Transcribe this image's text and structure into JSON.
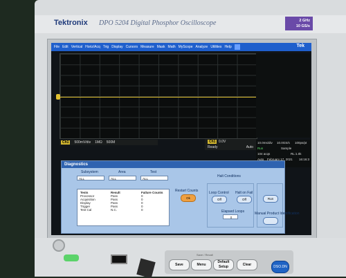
{
  "device": {
    "brand": "Tektronix",
    "model": "DPO 5204 Digital Phosphor Oscilloscope",
    "spec_line1": "2 GHz",
    "spec_line2": "10 GS/s"
  },
  "menubar": {
    "items": [
      "File",
      "Edit",
      "Vertical",
      "Horiz/Acq",
      "Trig",
      "Display",
      "Cursors",
      "Measure",
      "Mask",
      "Math",
      "MyScope",
      "Analyze",
      "Utilities",
      "Help"
    ],
    "logo": "Tek"
  },
  "channel": {
    "badge": "Ch1",
    "scale": "500mV/div",
    "impedance": "1MΩ",
    "bandwidth": "500M"
  },
  "trigger": {
    "badge": "Ch1",
    "level": "0.0V",
    "state": "Ready",
    "mode": "Auto"
  },
  "acquisition": {
    "timebase": "10.0ms/div",
    "rate": "10.0GS/s",
    "points": "100ps/pt",
    "run": "Run",
    "sample": "Sample",
    "acqs": "104 acqs",
    "rl": "RL:1.0k",
    "auto": "Auto",
    "date": "February 17, 2021",
    "time": "16:16:3"
  },
  "diagnostics": {
    "title": "Diagnostics",
    "subsystem_label": "Subsystem",
    "area_label": "Area",
    "test_label": "Test",
    "subsystem_value": "ALL",
    "area_value": "ALL",
    "test_value": "ALL",
    "results": {
      "headers": [
        "Tests",
        "Result",
        "Failure Counts"
      ],
      "tests": [
        "Processor",
        "Acquisition",
        "Display",
        "Trigger",
        "Test Cal"
      ],
      "results": [
        "Pass",
        "Pass",
        "Pass",
        "Pass",
        "N.C."
      ],
      "counts": [
        "0",
        "0",
        "0",
        "0",
        "0"
      ]
    },
    "restart_label": "Restart Counts",
    "restart_btn": "Ok",
    "halt_title": "Halt Conditions",
    "loop_continue": "Loop Control",
    "loop_continue_btn": "Off",
    "halt_on_fail": "Halt on Fail",
    "halt_on_fail_btn": "Off",
    "elapsed_loops": "Elapsed Loops",
    "elapsed_value": "0",
    "run_btn": "Run",
    "manual_label": "Manual Product Identification"
  },
  "front_panel": {
    "key_header": "Save / Recall",
    "keys": [
      "Save",
      "Menu",
      "Default Setup",
      "Clear"
    ],
    "default_key": "DSO.DN"
  }
}
